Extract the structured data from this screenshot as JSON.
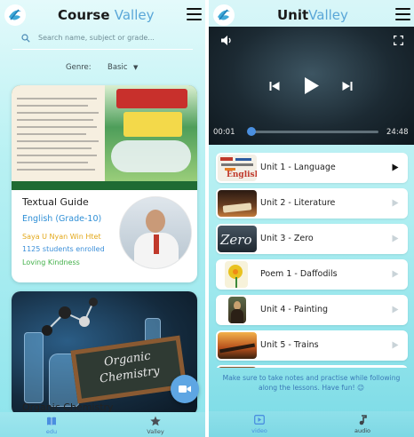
{
  "left": {
    "title_main": "Course",
    "title_accent": "Valley",
    "search": {
      "placeholder": "Search name, subject or grade..."
    },
    "genre": {
      "label": "Genre:",
      "value": "Basic"
    },
    "courses": [
      {
        "title": "Textual Guide",
        "subtitle": "English (Grade-10)",
        "teacher": "Saya U Nyan Win Htet",
        "enrolled": "1125 students enrolled",
        "tag": "Loving Kindness"
      },
      {
        "title": "Organic Chemistry",
        "image_text_line1": "Organic",
        "image_text_line2": "Chemistry"
      }
    ],
    "nav": [
      {
        "label": "edu",
        "icon": "book-icon",
        "active": true
      },
      {
        "label": "Valley",
        "icon": "star-icon",
        "active": false
      }
    ]
  },
  "right": {
    "title_main": "Unit",
    "title_accent": "Valley",
    "player": {
      "current_time": "00:01",
      "duration": "24:48",
      "progress": 0.03
    },
    "lessons": [
      {
        "label": "Unit 1 - Language",
        "active": true
      },
      {
        "label": "Unit 2 - Literature",
        "active": false
      },
      {
        "label": "Unit 3 - Zero",
        "active": false
      },
      {
        "label": "Poem 1 - Daffodils",
        "active": false
      },
      {
        "label": "Unit 4 - Painting",
        "active": false
      },
      {
        "label": "Unit 5 - Trains",
        "active": false
      }
    ],
    "thumb_text": {
      "zero": "Zero",
      "english": "English"
    },
    "notice": "Make sure to take notes and practise while following along the lessons. Have fun! 😉",
    "nav": [
      {
        "label": "video",
        "icon": "video-icon",
        "active": true
      },
      {
        "label": "audio",
        "icon": "music-note-icon",
        "active": false
      }
    ]
  },
  "colors": {
    "accent_blue": "#5aa7d8",
    "link_blue": "#2f8fd6",
    "orange": "#e3a81a",
    "green": "#43b04a",
    "player_blue": "#4a8fe0"
  }
}
